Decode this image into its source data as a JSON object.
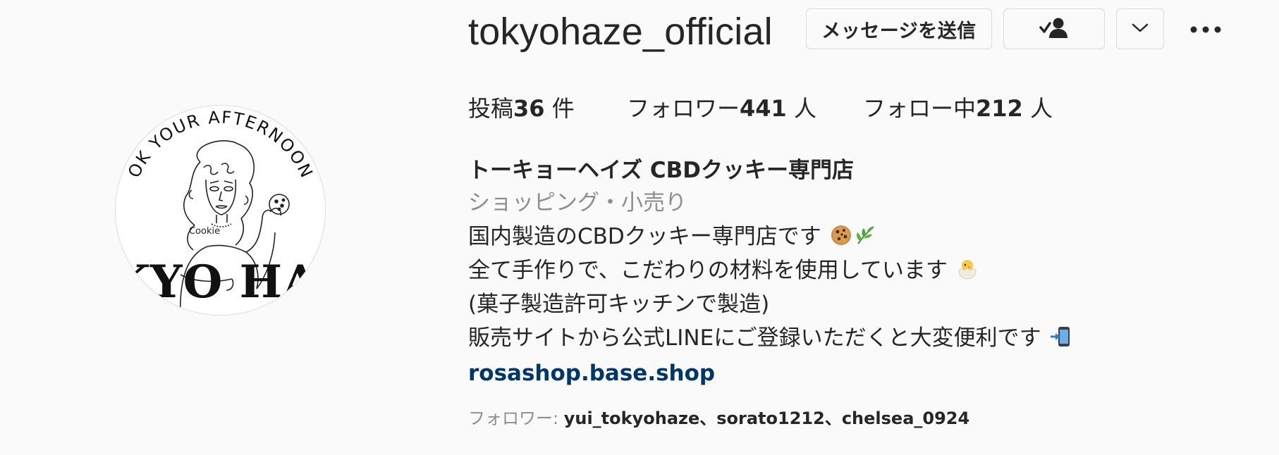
{
  "profile": {
    "username": "tokyohaze_official",
    "avatar_alt": "tokyohaze_official profile picture",
    "logo_arc_text": "OK YOUR AFTERNOON LI",
    "logo_cookie_text": "Cookie",
    "logo_bottom_text": "KYO HA"
  },
  "actions": {
    "message_label": "メッセージを送信",
    "follow_icon": "person-check-icon",
    "dropdown_icon": "chevron-down-icon",
    "more_icon": "more-options-icon"
  },
  "stats": {
    "posts_label": "投稿",
    "posts_count": "36",
    "posts_unit": " 件",
    "followers_label": "フォロワー",
    "followers_count": "441",
    "followers_unit": " 人",
    "following_label": "フォロー中",
    "following_count": "212",
    "following_unit": " 人"
  },
  "bio": {
    "full_name": "トーキョーヘイズ CBDクッキー専門店",
    "category": "ショッピング・小売り",
    "lines": [
      "国内製造のCBDクッキー専門店です",
      "全て手作りで、こだわりの材料を使用しています",
      "(菓子製造許可キッチンで製造)",
      "販売サイトから公式LINEにご登録いただくと大変便利です"
    ],
    "emojis": [
      "cookie-icon",
      "herb-icon",
      "hatching-chick-icon",
      "mobile-arrow-icon"
    ],
    "link": "rosashop.base.shop"
  },
  "followed_by": {
    "label": "フォロワー: ",
    "names": "yui_tokyohaze、sorato1212、chelsea_0924"
  },
  "colors": {
    "background": "#fafafa",
    "text": "#262626",
    "secondary_text": "#8e8e8e",
    "link": "#00376b",
    "border": "#dbdbdb"
  }
}
